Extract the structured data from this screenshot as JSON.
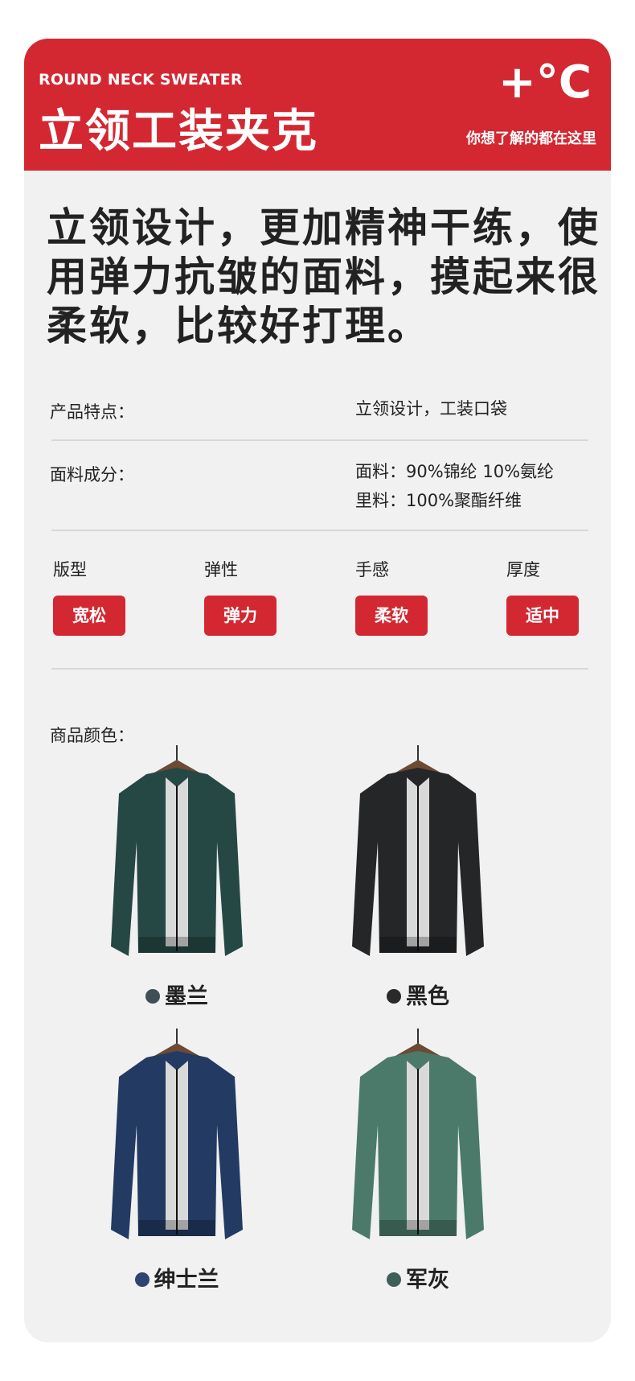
{
  "banner": {
    "subtitle_en": "ROUND NECK SWEATER",
    "title": "立领工装夹克",
    "symbol": "+°C",
    "tagline": "你想了解的都在这里"
  },
  "headline": "立领设计，更加精神干练，使用弹力抗皱的面料，摸起来很柔软，比较好打理。",
  "specs": {
    "features": {
      "label": "产品特点：",
      "value": "立领设计，工装口袋"
    },
    "fabric": {
      "label": "面料成分：",
      "value_line1": "面料：90%锦纶 10%氨纶",
      "value_line2": "里料：100%聚酯纤维"
    }
  },
  "attributes": [
    {
      "label": "版型",
      "value": "宽松"
    },
    {
      "label": "弹性",
      "value": "弹力"
    },
    {
      "label": "手感",
      "value": "柔软"
    },
    {
      "label": "厚度",
      "value": "适中"
    }
  ],
  "colors_label": "商品颜色：",
  "products": [
    {
      "name": "墨兰",
      "color": "#264844",
      "dot": "#3f4f55"
    },
    {
      "name": "黑色",
      "color": "#252628",
      "dot": "#2a2a2a"
    },
    {
      "name": "绅士兰",
      "color": "#233a63",
      "dot": "#2f4370"
    },
    {
      "name": "军灰",
      "color": "#4b7a6a",
      "dot": "#3f5e5a"
    }
  ]
}
